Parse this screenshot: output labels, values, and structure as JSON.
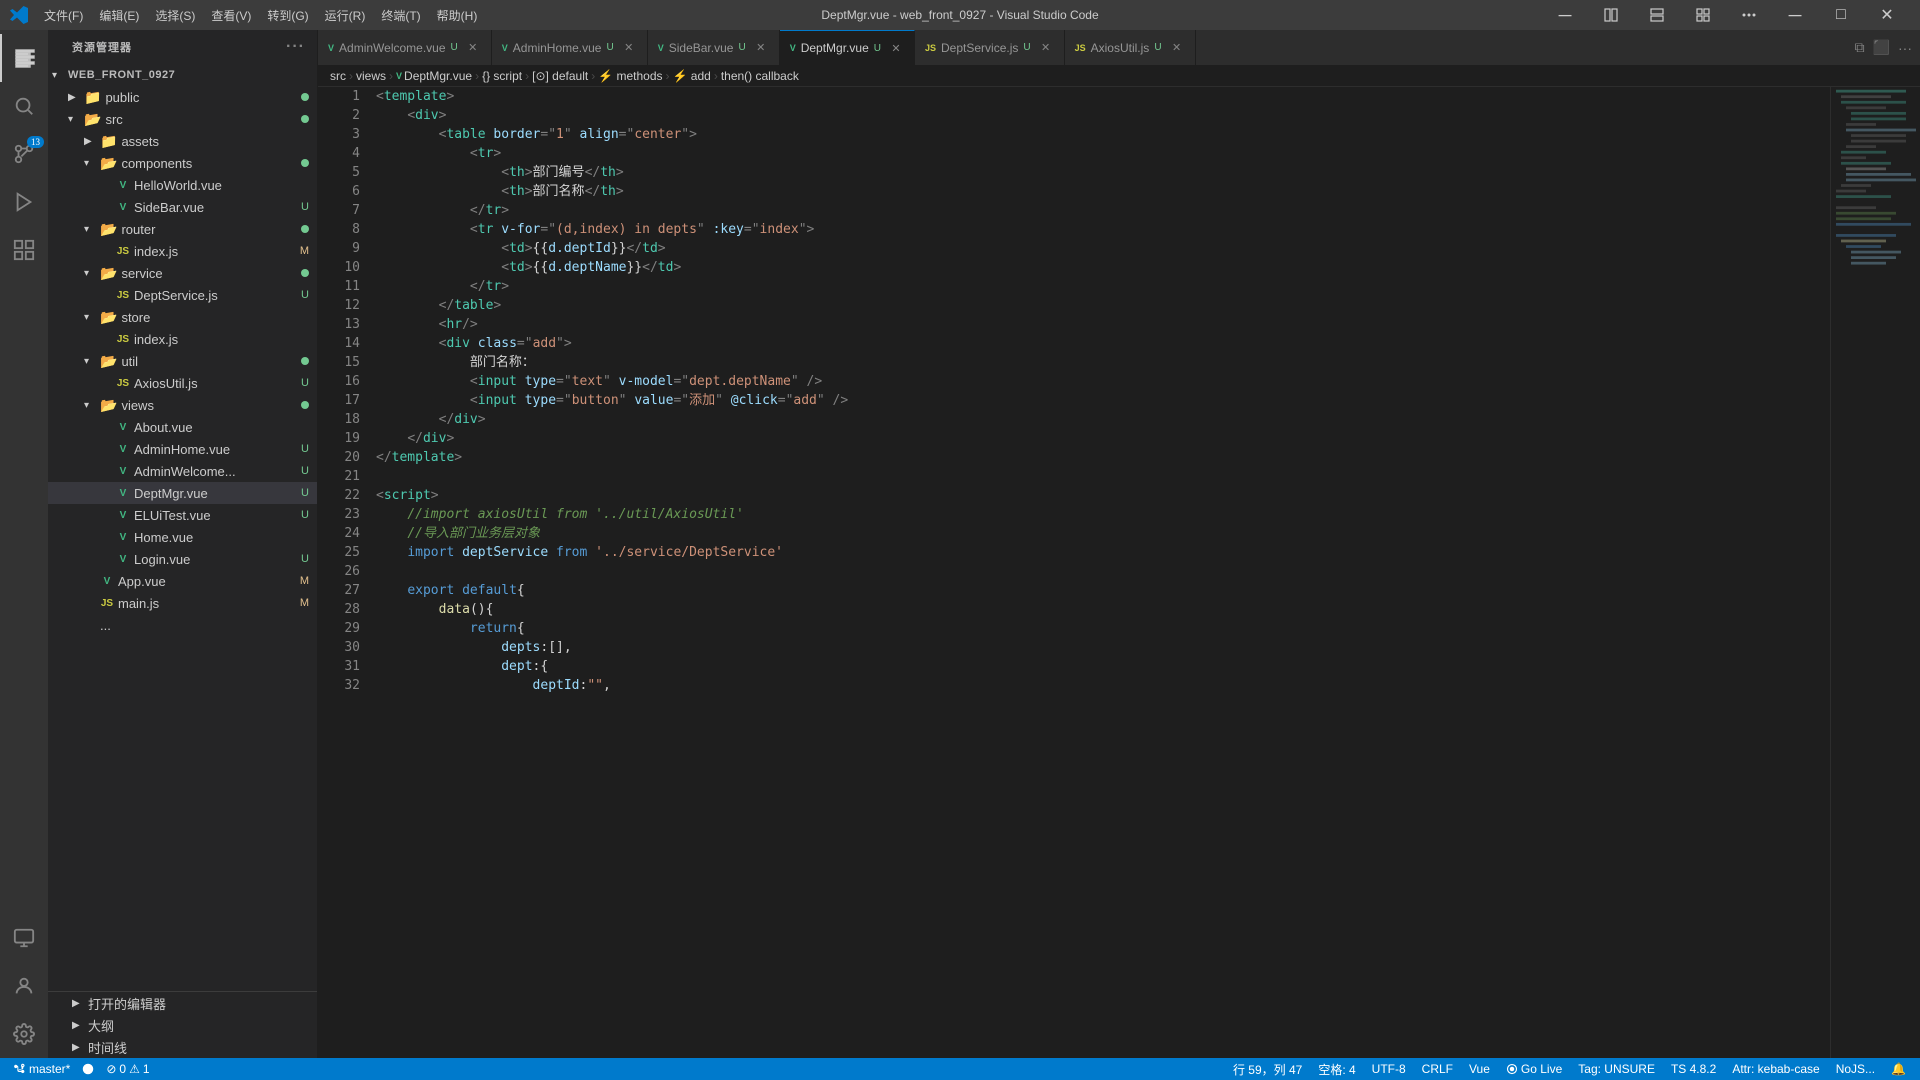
{
  "titlebar": {
    "icon": "VS",
    "menu": [
      "文件(F)",
      "编辑(E)",
      "选择(S)",
      "查看(V)",
      "转到(G)",
      "运行(R)",
      "终端(T)",
      "帮助(H)"
    ],
    "title": "DeptMgr.vue - web_front_0927 - Visual Studio Code",
    "controls": [
      "─",
      "□",
      "✕"
    ]
  },
  "tabs": [
    {
      "id": "tab-adminwelcome",
      "label": "AdminWelcome.vue",
      "type": "vue",
      "badge": "U",
      "active": false
    },
    {
      "id": "tab-adminhome",
      "label": "AdminHome.vue",
      "type": "vue",
      "badge": "U",
      "active": false
    },
    {
      "id": "tab-sidebar",
      "label": "SideBar.vue",
      "type": "vue",
      "badge": "U",
      "active": false
    },
    {
      "id": "tab-deptmgr",
      "label": "DeptMgr.vue",
      "type": "vue",
      "badge": "U",
      "active": true
    },
    {
      "id": "tab-deptservice",
      "label": "DeptService.js",
      "type": "js",
      "badge": "U",
      "active": false
    },
    {
      "id": "tab-axiosutil",
      "label": "AxiosUtil.js",
      "type": "js",
      "badge": "U",
      "active": false
    }
  ],
  "breadcrumb": [
    "src",
    "views",
    "DeptMgr.vue",
    "script",
    "default",
    "methods",
    "add",
    "then() callback"
  ],
  "sidebar": {
    "title": "资源管理器",
    "root": "WEB_FRONT_0927",
    "items": [
      {
        "label": "public",
        "type": "folder",
        "indent": 1,
        "expanded": false,
        "dot": "green"
      },
      {
        "label": "src",
        "type": "folder",
        "indent": 1,
        "expanded": true,
        "dot": "green"
      },
      {
        "label": "assets",
        "type": "folder",
        "indent": 2,
        "expanded": false,
        "dot": ""
      },
      {
        "label": "components",
        "type": "folder",
        "indent": 2,
        "expanded": true,
        "dot": "green"
      },
      {
        "label": "HelloWorld.vue",
        "type": "vue",
        "indent": 3,
        "badge": ""
      },
      {
        "label": "SideBar.vue",
        "type": "vue",
        "indent": 3,
        "badge": "U"
      },
      {
        "label": "router",
        "type": "folder",
        "indent": 2,
        "expanded": true,
        "dot": "green"
      },
      {
        "label": "index.js",
        "type": "js",
        "indent": 3,
        "badge": "M"
      },
      {
        "label": "service",
        "type": "folder",
        "indent": 2,
        "expanded": true,
        "dot": "green"
      },
      {
        "label": "DeptService.js",
        "type": "js",
        "indent": 3,
        "badge": "U"
      },
      {
        "label": "store",
        "type": "folder",
        "indent": 2,
        "expanded": true,
        "dot": ""
      },
      {
        "label": "index.js",
        "type": "js",
        "indent": 3,
        "badge": ""
      },
      {
        "label": "util",
        "type": "folder",
        "indent": 2,
        "expanded": true,
        "dot": "green"
      },
      {
        "label": "AxiosUtil.js",
        "type": "js",
        "indent": 3,
        "badge": "U"
      },
      {
        "label": "views",
        "type": "folder",
        "indent": 2,
        "expanded": true,
        "dot": "green"
      },
      {
        "label": "About.vue",
        "type": "vue",
        "indent": 3,
        "badge": ""
      },
      {
        "label": "AdminHome.vue",
        "type": "vue",
        "indent": 3,
        "badge": "U"
      },
      {
        "label": "AdminWelcome...",
        "type": "vue",
        "indent": 3,
        "badge": "U"
      },
      {
        "label": "DeptMgr.vue",
        "type": "vue",
        "indent": 3,
        "badge": "U",
        "active": true
      },
      {
        "label": "ELUiTest.vue",
        "type": "vue",
        "indent": 3,
        "badge": "U"
      },
      {
        "label": "Home.vue",
        "type": "vue",
        "indent": 3,
        "badge": ""
      },
      {
        "label": "Login.vue",
        "type": "vue",
        "indent": 3,
        "badge": "U"
      },
      {
        "label": "App.vue",
        "type": "vue",
        "indent": 2,
        "badge": "M"
      },
      {
        "label": "main.js",
        "type": "js",
        "indent": 2,
        "badge": "M"
      },
      {
        "label": "...",
        "type": "text",
        "indent": 2,
        "badge": ""
      }
    ],
    "footer": [
      "打开的编辑器",
      "大纲",
      "时间线"
    ]
  },
  "code": {
    "lines": [
      {
        "num": 1,
        "content": "<template>"
      },
      {
        "num": 2,
        "content": "    <div>"
      },
      {
        "num": 3,
        "content": "        <table border=\"1\" align=\"center\">"
      },
      {
        "num": 4,
        "content": "            <tr>"
      },
      {
        "num": 5,
        "content": "                <th>部门编号</th>"
      },
      {
        "num": 6,
        "content": "                <th>部门名称</th>"
      },
      {
        "num": 7,
        "content": "            </tr>"
      },
      {
        "num": 8,
        "content": "            <tr v-for=\"(d,index) in depts\" :key=\"index\">"
      },
      {
        "num": 9,
        "content": "                <td>{{d.deptId}}</td>"
      },
      {
        "num": 10,
        "content": "                <td>{{d.deptName}}</td>"
      },
      {
        "num": 11,
        "content": "            </tr>"
      },
      {
        "num": 12,
        "content": "        </table>"
      },
      {
        "num": 13,
        "content": "        <hr/>"
      },
      {
        "num": 14,
        "content": "        <div class=\"add\">"
      },
      {
        "num": 15,
        "content": "            部门名称："
      },
      {
        "num": 16,
        "content": "            <input type=\"text\" v-model=\"dept.deptName\" />"
      },
      {
        "num": 17,
        "content": "            <input type=\"button\" value=\"添加\" @click=\"add\" />"
      },
      {
        "num": 18,
        "content": "        </div>"
      },
      {
        "num": 19,
        "content": "    </div>"
      },
      {
        "num": 20,
        "content": "</template>"
      },
      {
        "num": 21,
        "content": ""
      },
      {
        "num": 22,
        "content": "<script>"
      },
      {
        "num": 23,
        "content": "    //import axiosUtil from '../util/AxiosUtil'"
      },
      {
        "num": 24,
        "content": "    //导入部门业务层对象"
      },
      {
        "num": 25,
        "content": "    import deptService from '../service/DeptService'"
      },
      {
        "num": 26,
        "content": ""
      },
      {
        "num": 27,
        "content": "    export default{"
      },
      {
        "num": 28,
        "content": "        data(){"
      },
      {
        "num": 29,
        "content": "            return{"
      },
      {
        "num": 30,
        "content": "                depts:[],"
      },
      {
        "num": 31,
        "content": "                dept:{"
      },
      {
        "num": 32,
        "content": "                    deptId:\"\","
      }
    ]
  },
  "statusbar": {
    "branch": "master*",
    "sync": "",
    "errors": "0",
    "warnings": "1",
    "position": "行 59，列 47",
    "spaces": "空格: 4",
    "encoding": "UTF-8",
    "eol": "CRLF",
    "language": "Vue",
    "golive": "Go Live",
    "tag": "Tag: UNSURE",
    "ts": "TS 4.8.2",
    "attr": "Attr: kebab-case",
    "notif": "NoJS..."
  }
}
